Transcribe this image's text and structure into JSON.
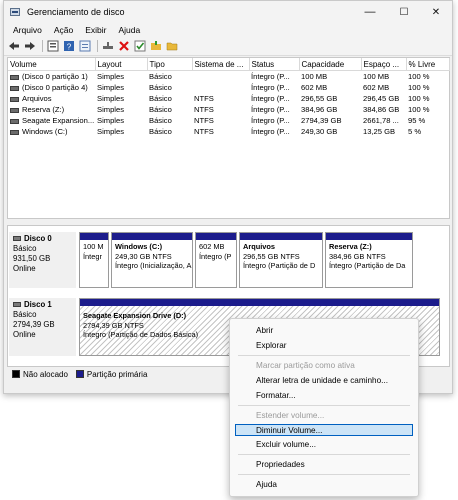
{
  "window": {
    "title": "Gerenciamento de disco",
    "minimize": "—",
    "maximize": "☐",
    "close": "✕"
  },
  "menu": [
    "Arquivo",
    "Ação",
    "Exibir",
    "Ajuda"
  ],
  "toolbar_icons": [
    "back-arrow-icon",
    "forward-arrow-icon",
    "disk-list-icon",
    "help-icon",
    "properties-icon",
    "connect-icon",
    "delete-icon",
    "check-icon",
    "open-folder-icon",
    "folder-icon"
  ],
  "volume_table": {
    "columns": [
      "Volume",
      "Layout",
      "Tipo",
      "Sistema de ...",
      "Status",
      "Capacidade",
      "Espaço ...",
      "% Livre"
    ],
    "rows": [
      [
        "(Disco 0 partição 1)",
        "Simples",
        "Básico",
        "",
        "Íntegro (P...",
        "100 MB",
        "100 MB",
        "100 %"
      ],
      [
        "(Disco 0 partição 4)",
        "Simples",
        "Básico",
        "",
        "Íntegro (P...",
        "602 MB",
        "602 MB",
        "100 %"
      ],
      [
        "Arquivos",
        "Simples",
        "Básico",
        "NTFS",
        "Íntegro (P...",
        "296,55 GB",
        "296,45 GB",
        "100 %"
      ],
      [
        "Reserva (Z:)",
        "Simples",
        "Básico",
        "NTFS",
        "Íntegro (P...",
        "384,96 GB",
        "384,86 GB",
        "100 %"
      ],
      [
        "Seagate Expansion...",
        "Simples",
        "Básico",
        "NTFS",
        "Íntegro (P...",
        "2794,39 GB",
        "2661,78 ...",
        "95 %"
      ],
      [
        "Windows (C:)",
        "Simples",
        "Básico",
        "NTFS",
        "Íntegro (P...",
        "249,30 GB",
        "13,25 GB",
        "5 %"
      ]
    ]
  },
  "disks": [
    {
      "name": "Disco 0",
      "type": "Básico",
      "size": "931,50 GB",
      "status": "Online",
      "partitions": [
        {
          "title": "",
          "line1": "100 M",
          "line2": "Íntegr"
        },
        {
          "title": "Windows  (C:)",
          "line1": "249,30 GB NTFS",
          "line2": "Íntegro (Inicialização, A"
        },
        {
          "title": "",
          "line1": "602 MB",
          "line2": "Íntegro (P"
        },
        {
          "title": "Arquivos",
          "line1": "296,55 GB NTFS",
          "line2": "Íntegro (Partição de D"
        },
        {
          "title": "Reserva  (Z:)",
          "line1": "384,96 GB NTFS",
          "line2": "Íntegro (Partição de Da"
        }
      ]
    },
    {
      "name": "Disco 1",
      "type": "Básico",
      "size": "2794,39 GB",
      "status": "Online",
      "partitions": [
        {
          "title": "Seagate Expansion Drive  (D:)",
          "line1": "2794,39 GB NTFS",
          "line2": "Íntegro (Partição de Dados Básica)"
        }
      ]
    }
  ],
  "legend": [
    {
      "label": "Não alocado",
      "color": "#000000"
    },
    {
      "label": "Partição primária",
      "color": "#1c1c8c"
    }
  ],
  "context_menu": {
    "items": [
      {
        "label": "Abrir",
        "enabled": true
      },
      {
        "label": "Explorar",
        "enabled": true
      },
      {
        "label": "Marcar partição como ativa",
        "enabled": false
      },
      {
        "label": "Alterar letra de unidade e caminho...",
        "enabled": true
      },
      {
        "label": "Formatar...",
        "enabled": true
      },
      {
        "label": "Estender volume...",
        "enabled": false
      },
      {
        "label": "Diminuir Volume...",
        "enabled": true,
        "selected": true
      },
      {
        "label": "Excluir volume...",
        "enabled": true
      },
      {
        "label": "Propriedades",
        "enabled": true
      },
      {
        "label": "Ajuda",
        "enabled": true
      }
    ]
  }
}
